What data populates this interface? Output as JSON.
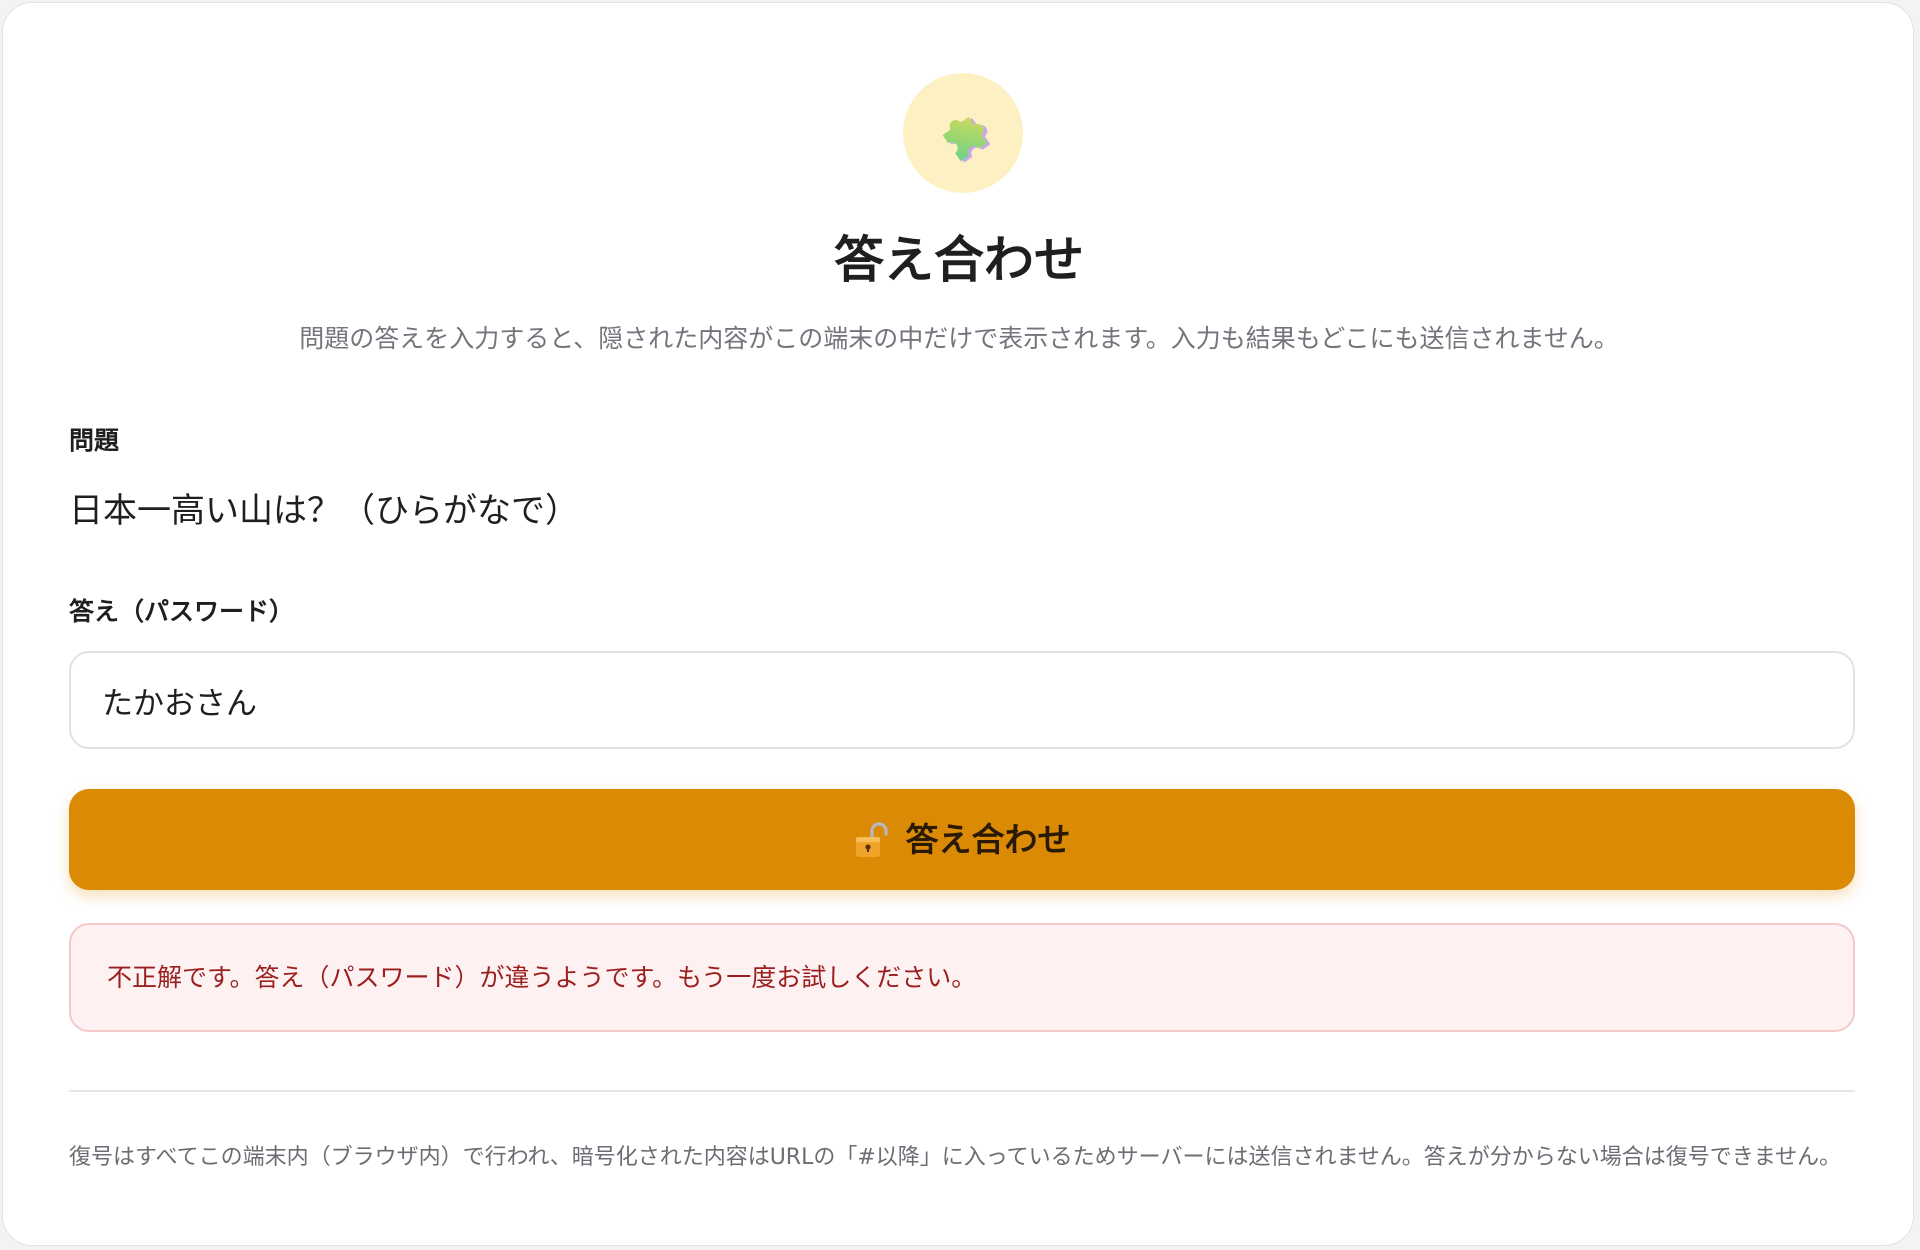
{
  "header": {
    "icon": "puzzle-piece-icon",
    "title": "答え合わせ",
    "subtitle": "問題の答えを入力すると、隠された内容がこの端末の中だけで表示されます。入力も結果もどこにも送信されません。"
  },
  "question": {
    "label": "問題",
    "text": "日本一高い山は？（ひらがなで）"
  },
  "answer": {
    "label": "答え（パスワード）",
    "value": "たかおさん",
    "placeholder": ""
  },
  "submit": {
    "icon": "unlocked-padlock-icon",
    "label": "答え合わせ"
  },
  "error": {
    "message": "不正解です。答え（パスワード）が違うようです。もう一度お試しください。"
  },
  "footer": {
    "note": "復号はすべてこの端末内（ブラウザ内）で行われ、暗号化された内容はURLの「#以降」に入っているためサーバーには送信されません。答えが分からない場合は復号できません。"
  },
  "colors": {
    "accent": "#db8a06",
    "icon_background": "#fdf1c4",
    "error_background": "#fef1f1",
    "error_border": "#f5c9c9",
    "error_text": "#9a1f1f"
  }
}
